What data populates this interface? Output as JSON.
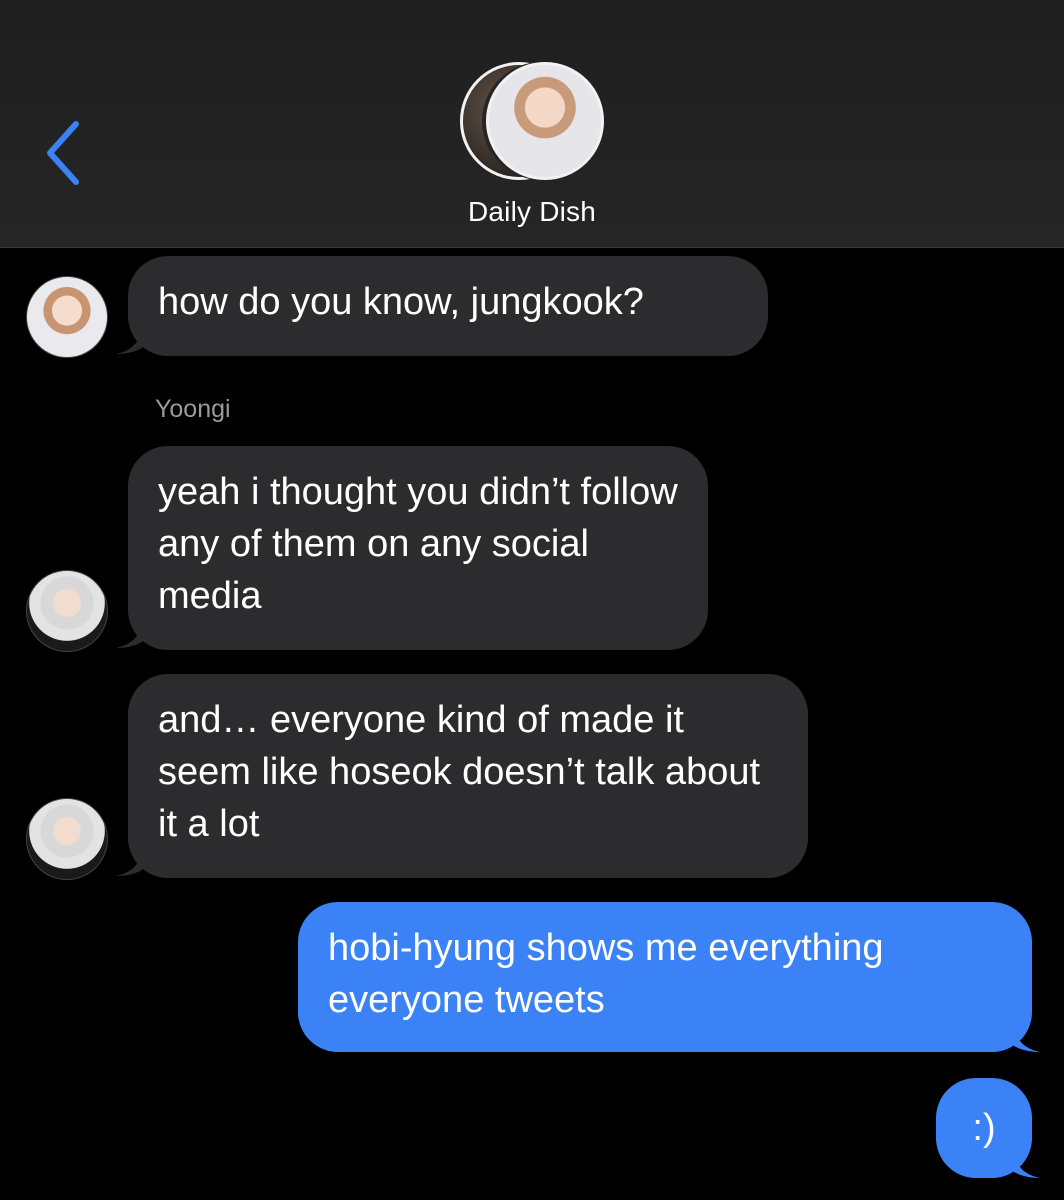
{
  "header": {
    "back_icon": "chevron-left-icon",
    "group_name": "Daily Dish",
    "accent_color": "#3b82f6"
  },
  "messages": [
    {
      "direction": "incoming",
      "sender": "",
      "text": "how do you know, jungkook?"
    },
    {
      "direction": "incoming",
      "sender": "Yoongi",
      "text": "yeah i thought you didn’t follow any of them on any social media"
    },
    {
      "direction": "incoming",
      "sender": "",
      "text": "and… everyone kind of made it seem like hoseok doesn’t talk about it a lot"
    },
    {
      "direction": "outgoing",
      "sender": "",
      "text": "hobi-hyung shows me everything everyone tweets"
    },
    {
      "direction": "outgoing",
      "sender": "",
      "text": ":)"
    }
  ],
  "colors": {
    "incoming_bubble": "#2c2c2e",
    "outgoing_bubble": "#3b82f6",
    "background": "#000000"
  }
}
